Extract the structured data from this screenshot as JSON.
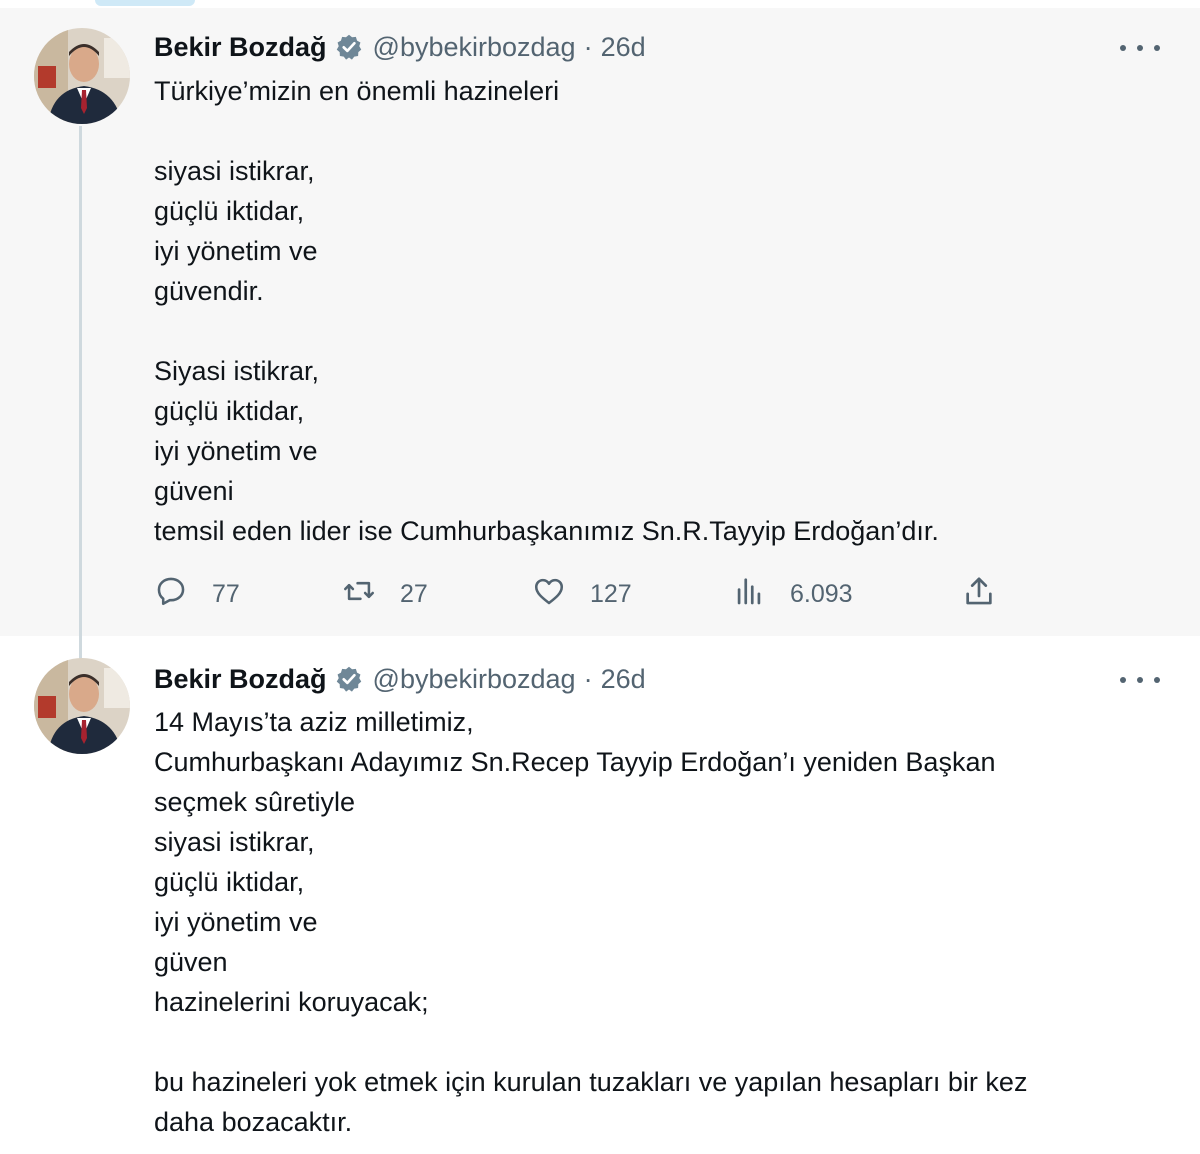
{
  "colors": {
    "text_primary": "#0f1419",
    "text_secondary": "#536471",
    "verified_badge": "#6f8797",
    "tweet1_background": "#f7f7f7",
    "thread_line": "#cfd9de"
  },
  "tweets": [
    {
      "author_name": "Bekir Bozdağ",
      "handle": "@bybekirbozdag",
      "separator": "·",
      "time": "26d",
      "verified_icon": "verified-badge-icon",
      "more_icon": "more-dots-icon",
      "text": "Türkiye’mizin en önemli hazineleri\n\nsiyasi istikrar,\ngüçlü iktidar,\niyi yönetim ve\ngüvendir.\n\nSiyasi istikrar,\ngüçlü iktidar,\niyi yönetim ve\ngüveni\ntemsil eden lider ise Cumhurbaşkanımız Sn.R.Tayyip Erdoğan’dır.",
      "stats": {
        "replies": "77",
        "retweets": "27",
        "likes": "127",
        "views": "6.093"
      },
      "action_icons": [
        "reply-icon",
        "retweet-icon",
        "like-icon",
        "views-icon",
        "share-icon"
      ]
    },
    {
      "author_name": "Bekir Bozdağ",
      "handle": "@bybekirbozdag",
      "separator": "·",
      "time": "26d",
      "verified_icon": "verified-badge-icon",
      "more_icon": "more-dots-icon",
      "text": "14 Mayıs’ta aziz milletimiz,\nCumhurbaşkanı Adayımız Sn.Recep Tayyip Erdoğan’ı yeniden Başkan\nseçmek sûretiyle\nsiyasi istikrar,\ngüçlü iktidar,\niyi yönetim ve\ngüven\nhazinelerini koruyacak;\n\nbu hazineleri yok etmek için kurulan tuzakları ve yapılan hesapları bir kez\ndaha bozacaktır."
    }
  ]
}
